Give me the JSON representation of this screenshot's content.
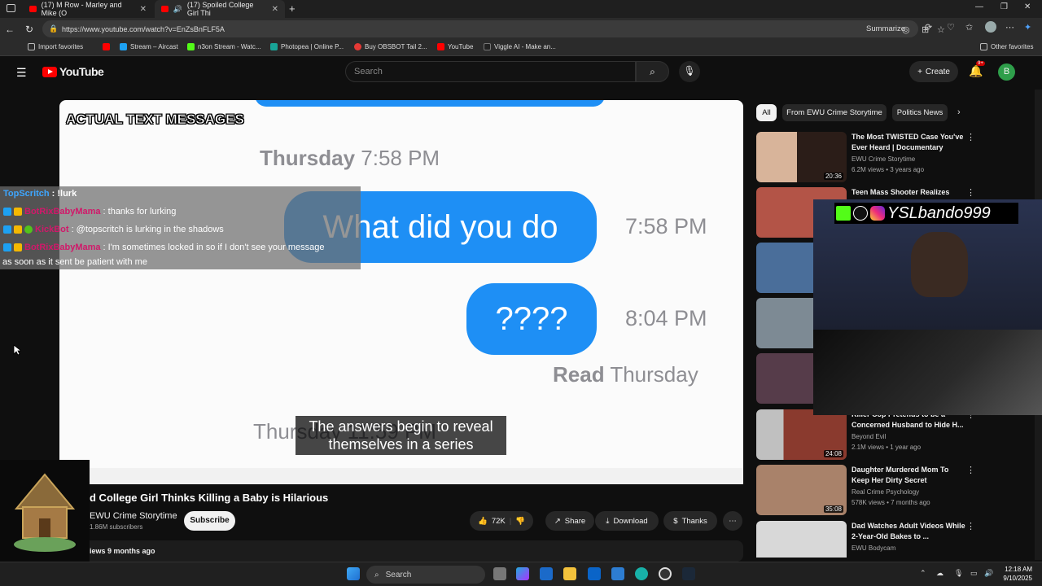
{
  "browser": {
    "tabs": [
      {
        "title": "(17) M Row - Marley and Mike (O",
        "active": false
      },
      {
        "title": "(17) Spoiled College Girl Thi",
        "active": true
      }
    ],
    "url": "https://www.youtube.com/watch?v=EnZsBnFLF5A",
    "summarize": "Summarize",
    "bookmarks": [
      {
        "label": "Import favorites",
        "color": "#bbbbbb"
      },
      {
        "label": "",
        "color": "#ff0000"
      },
      {
        "label": "Stream – Aircast",
        "color": "#1da1f2"
      },
      {
        "label": "n3on Stream - Watc...",
        "color": "#53fc18"
      },
      {
        "label": "Photopea | Online P...",
        "color": "#18a497"
      },
      {
        "label": "Buy OBSBOT Tail 2...",
        "color": "#e53935"
      },
      {
        "label": "YouTube",
        "color": "#ff0000"
      },
      {
        "label": "Viggle AI - Make an...",
        "color": "#222222"
      }
    ],
    "other_favorites": "Other favorites"
  },
  "youtube": {
    "logo_text": "YouTube",
    "search_placeholder": "Search",
    "create_label": "Create",
    "notification_count": "9+",
    "avatar_letter": "B"
  },
  "video": {
    "overlay_title": "ACTUAL TEXT MESSAGES",
    "day1": "Thursday",
    "time1": "7:58 PM",
    "bubble1": "What did you do",
    "bubble1_time": "7:58 PM",
    "bubble2": "????",
    "bubble2_time": "8:04 PM",
    "read_label": "Read",
    "read_day": "Thursday",
    "bottom_stamp": "Thursday 11:59 PM",
    "caption": "The answers begin to reveal themselves in a series"
  },
  "chat": [
    {
      "user": "TopScritch",
      "user_color": "#3ea6ff",
      "message": ": !lurk"
    },
    {
      "user": "BotRixBabyMama",
      "user_color": "#d1186a",
      "message": ": thanks for lurking"
    },
    {
      "user": "KickBot",
      "user_color": "#d1186a",
      "message": ": @topscritch is lurking in the shadows"
    },
    {
      "user": "BotRixBabyMama",
      "user_color": "#d1186a",
      "message": ": I'm sometimes locked in so if I don't see your message"
    },
    {
      "user": "",
      "user_color": "#ffffff",
      "message": "as soon as it sent be patient with me"
    }
  ],
  "below_video": {
    "title": "d College Girl Thinks Killing a Baby is Hilarious",
    "channel": "EWU Crime Storytime",
    "subscribers": "1.86M subscribers",
    "subscribe": "Subscribe",
    "likes": "72K",
    "share": "Share",
    "download": "Download",
    "thanks": "Thanks",
    "views_line": "iews  9 months ago"
  },
  "sidebar": {
    "chips": [
      "All",
      "From EWU Crime Storytime",
      "Politics News"
    ],
    "recs": [
      {
        "title": "The Most TWISTED Case You've Ever Heard | Documentary",
        "channel": "EWU Crime Storytime",
        "meta": "6.2M views • 3 years ago",
        "duration": "20:36",
        "thumb": "#6b4a3a"
      },
      {
        "title": "Teen Mass Shooter Realizes",
        "channel": "",
        "meta": "",
        "duration": "",
        "thumb": "#b35447"
      },
      {
        "title": "",
        "channel": "",
        "meta": "",
        "duration": "",
        "thumb": "#4a6e9a"
      },
      {
        "title": "",
        "channel": "",
        "meta": "",
        "duration": "",
        "thumb": "#7d8a94"
      },
      {
        "title": "",
        "channel": "",
        "meta": "",
        "duration": "",
        "thumb": "#563c4a"
      },
      {
        "title": "Killer Cop Pretends to be a Concerned Husband to Hide H...",
        "channel": "Beyond Evil",
        "meta": "2.1M views • 1 year ago",
        "duration": "24:08",
        "thumb": "#8a3a2e"
      },
      {
        "title": "Daughter Murdered Mom To Keep Her Dirty Secret",
        "channel": "Real Crime Psychology",
        "meta": "578K views • 7 months ago",
        "duration": "35:08",
        "thumb": "#a9826a"
      },
      {
        "title": "Dad Watches Adult Videos While 2-Year-Old Bakes to ...",
        "channel": "EWU Bodycam",
        "meta": "",
        "duration": "",
        "thumb": "#d8d8d8"
      }
    ]
  },
  "stream": {
    "handle": "YSLbando999"
  },
  "taskbar": {
    "search": "Search",
    "time": "12:18 AM",
    "date": "9/10/2025"
  }
}
